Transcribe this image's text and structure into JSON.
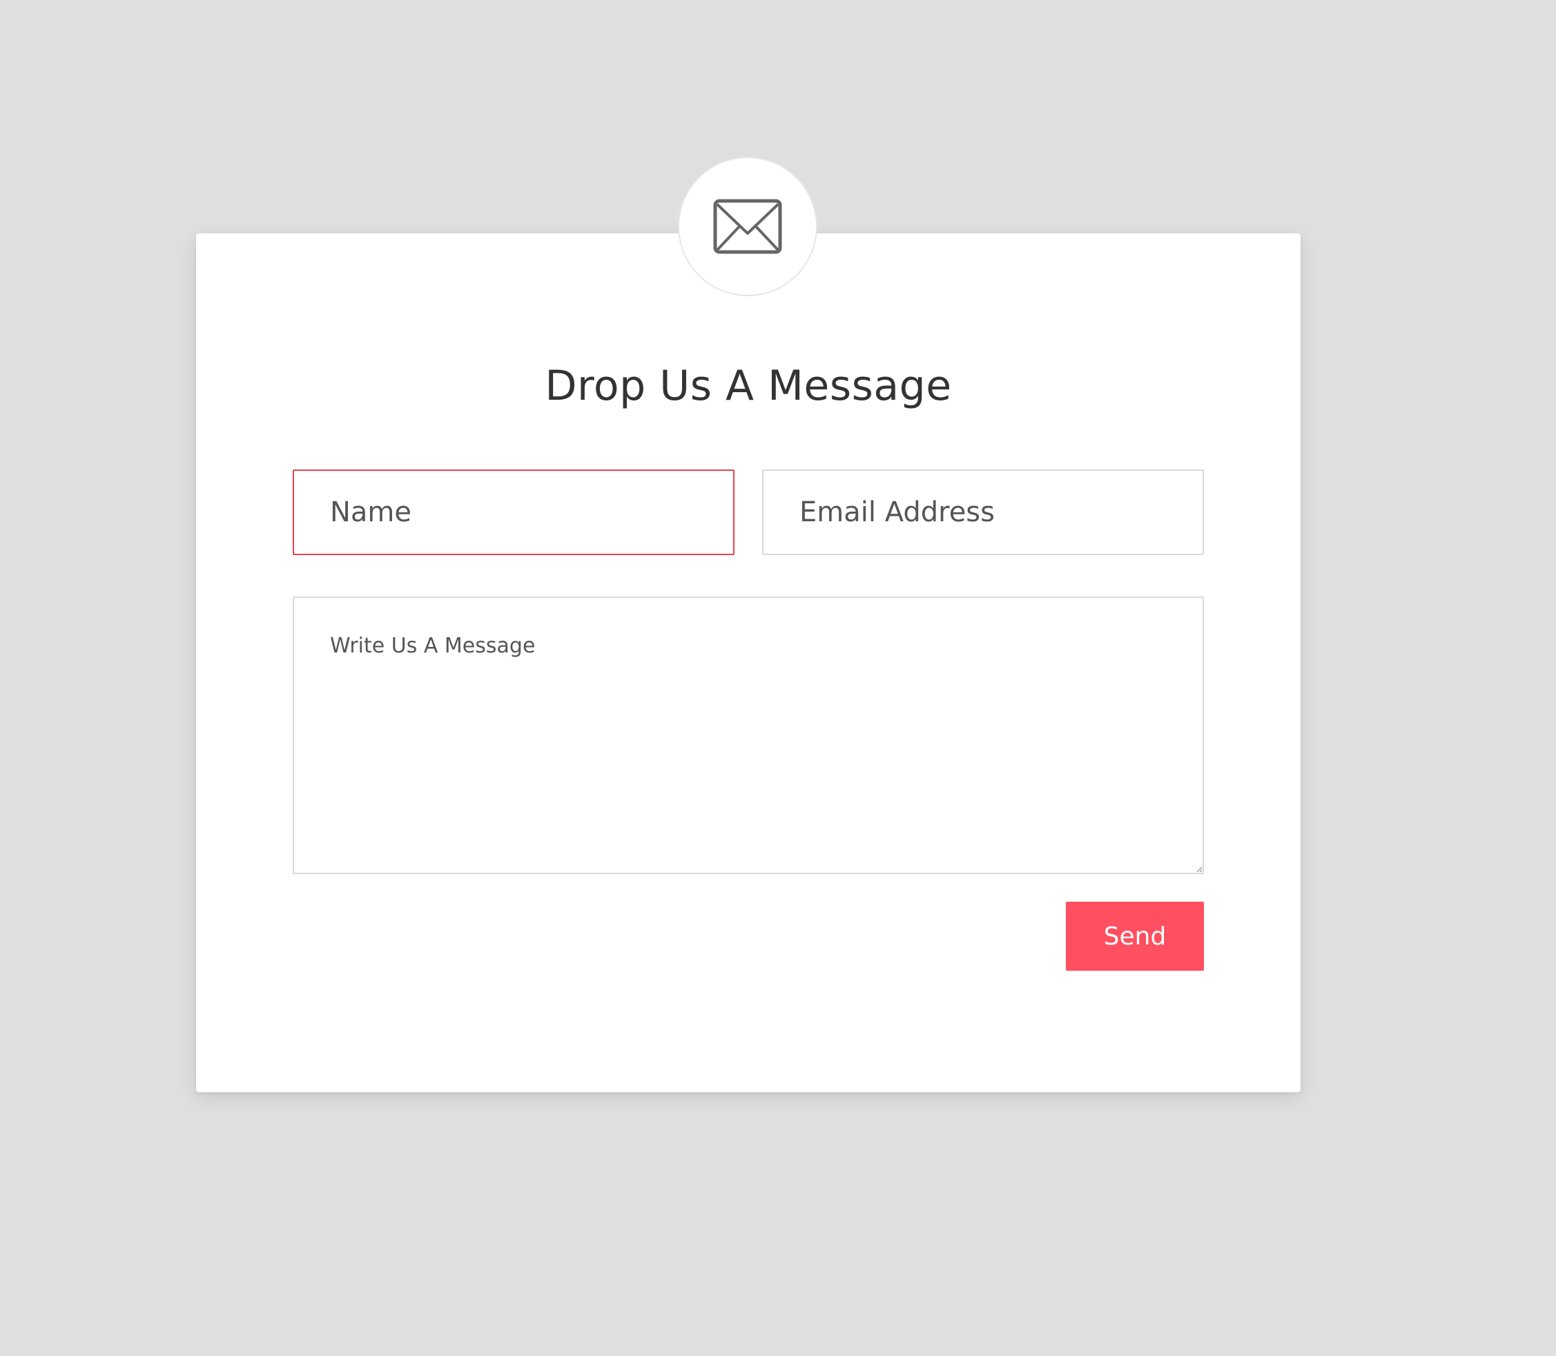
{
  "contact_form": {
    "icon": "envelope-icon",
    "title": "Drop Us A Message",
    "name_field": {
      "placeholder": "Name",
      "value": ""
    },
    "email_field": {
      "placeholder": "Email Address",
      "value": ""
    },
    "message_field": {
      "placeholder": "Write Us A Message",
      "value": ""
    },
    "send_label": "Send"
  },
  "colors": {
    "page_background": "#dfdfdf",
    "card_background": "#ffffff",
    "accent": "#ff4f60",
    "invalid_border": "#e8434f",
    "field_border": "#d9d9d9",
    "title_text": "#333333"
  }
}
